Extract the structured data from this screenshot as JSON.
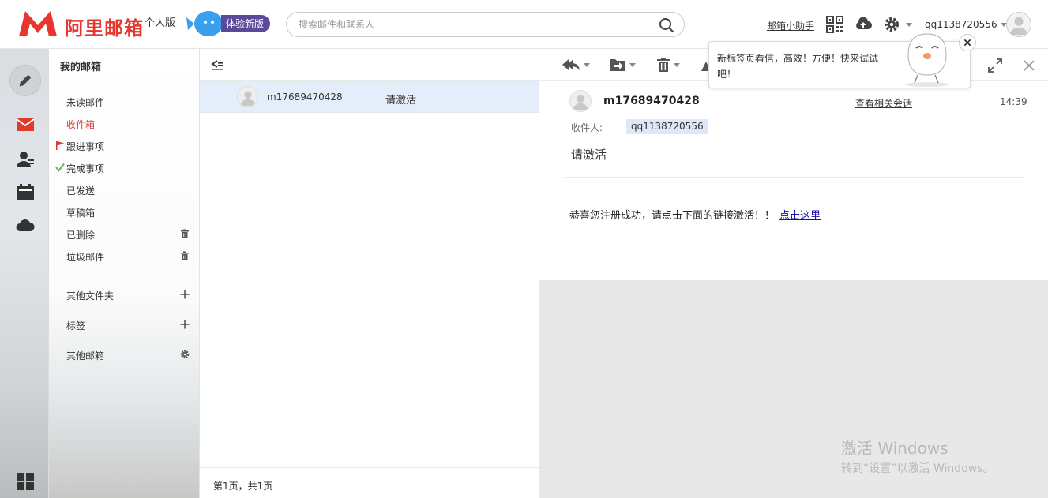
{
  "brand": {
    "name": "阿里邮箱",
    "edition": "个人版",
    "try_new": "体验新版",
    "color": "#e8352e"
  },
  "search": {
    "placeholder": "搜索邮件和联系人"
  },
  "header": {
    "helper_link": "邮箱小助手",
    "username": "qq1138720556"
  },
  "rail": {
    "icons": [
      "compose-icon",
      "mail-icon",
      "contacts-icon",
      "calendar-icon",
      "cloud-icon",
      "apps-icon"
    ]
  },
  "folders": {
    "title": "我的邮箱",
    "items": [
      {
        "label": "未读邮件"
      },
      {
        "label": "收件箱",
        "active": true
      },
      {
        "label": "跟进事项",
        "icon": "flag-icon"
      },
      {
        "label": "完成事项",
        "icon": "check-icon"
      },
      {
        "label": "已发送"
      },
      {
        "label": "草稿箱"
      },
      {
        "label": "已删除",
        "action": "trash-icon"
      },
      {
        "label": "垃圾邮件",
        "action": "trash-icon"
      }
    ],
    "other_folders": "其他文件夹",
    "tags": "标签",
    "other_mailboxes": "其他邮箱"
  },
  "list": {
    "rows": [
      {
        "from": "m17689470428",
        "subject": "请激活"
      }
    ],
    "pagination": "第1页，共1页"
  },
  "reader": {
    "sender": "m17689470428",
    "related_link": "查看相关会话",
    "time": "14:39",
    "to_label": "收件人:",
    "to": "qq1138720556",
    "subject": "请激活",
    "body": "恭喜您注册成功，请点击下面的链接激活！！",
    "link_text": "点击这里"
  },
  "tip": {
    "text": "新标签页看信，高效！方便！快来试试吧！"
  },
  "watermark": {
    "title": "激活 Windows",
    "subtitle": "转到“设置”以激活 Windows。"
  }
}
